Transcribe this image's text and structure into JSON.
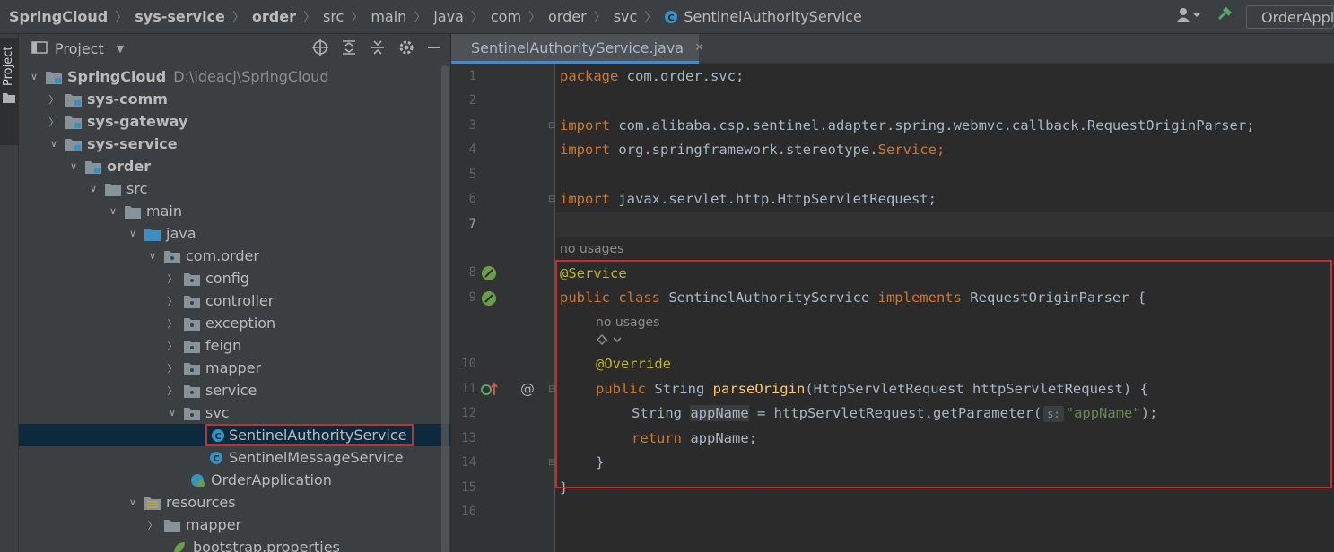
{
  "navbar": {
    "breadcrumbs": [
      "SpringCloud",
      "sys-service",
      "order",
      "src",
      "main",
      "java",
      "com",
      "order",
      "svc"
    ],
    "current_file": "SentinelAuthorityService",
    "run_config": "OrderApplication"
  },
  "stripe": {
    "label": "Project"
  },
  "project_panel": {
    "title": "Project",
    "tree": [
      {
        "label": "SpringCloud",
        "path": "D:\\ideacj\\SpringCloud",
        "bold": true,
        "expanded": true,
        "icon": "module"
      },
      {
        "label": "sys-comm",
        "bold": true,
        "expanded": false,
        "icon": "module"
      },
      {
        "label": "sys-gateway",
        "bold": true,
        "expanded": false,
        "icon": "module"
      },
      {
        "label": "sys-service",
        "bold": true,
        "expanded": true,
        "icon": "module"
      },
      {
        "label": "order",
        "bold": true,
        "expanded": true,
        "icon": "module"
      },
      {
        "label": "src",
        "expanded": true,
        "icon": "folder"
      },
      {
        "label": "main",
        "expanded": true,
        "icon": "folder"
      },
      {
        "label": "java",
        "expanded": true,
        "icon": "source-folder"
      },
      {
        "label": "com.order",
        "expanded": true,
        "icon": "package"
      },
      {
        "label": "config",
        "expanded": false,
        "icon": "package"
      },
      {
        "label": "controller",
        "expanded": false,
        "icon": "package"
      },
      {
        "label": "exception",
        "expanded": false,
        "icon": "package"
      },
      {
        "label": "feign",
        "expanded": false,
        "icon": "package"
      },
      {
        "label": "mapper",
        "expanded": false,
        "icon": "package"
      },
      {
        "label": "service",
        "expanded": false,
        "icon": "package"
      },
      {
        "label": "svc",
        "expanded": true,
        "icon": "package"
      },
      {
        "label": "SentinelAuthorityService",
        "icon": "class",
        "selected": true
      },
      {
        "label": "SentinelMessageService",
        "icon": "class"
      },
      {
        "label": "OrderApplication",
        "icon": "spring-class"
      },
      {
        "label": "resources",
        "expanded": true,
        "icon": "resources-folder"
      },
      {
        "label": "mapper",
        "expanded": false,
        "icon": "folder"
      },
      {
        "label": "bootstrap.properties",
        "icon": "properties-file"
      }
    ]
  },
  "editor": {
    "tab_label": "SentinelAuthorityService.java",
    "line_numbers": [
      "1",
      "2",
      "3",
      "4",
      "5",
      "6",
      "7",
      "8",
      "9",
      "10",
      "11",
      "12",
      "13",
      "14",
      "15",
      "16"
    ],
    "code": {
      "l1_kw": "package",
      "l1_rest": " com.order.svc;",
      "l3_kw": "import",
      "l3_rest": " com.alibaba.csp.sentinel.adapter.spring.webmvc.callback.RequestOriginParser;",
      "l4_kw": "import",
      "l4_rest": " org.springframework.stereotype.",
      "l4_cls": "Service",
      "l4_end": ";",
      "l6_kw": "import",
      "l6_rest": " javax.servlet.http.HttpServletRequest;",
      "hint_no_usages_1": "no usages",
      "l8_ann": "@Service",
      "l9_kw1": "public class",
      "l9_name": " SentinelAuthorityService ",
      "l9_kw2": "implements",
      "l9_rest": " RequestOriginParser {",
      "hint_no_usages_2": "no usages",
      "l10_ann": "@Override",
      "l11_kw": "public",
      "l11_type": " String ",
      "l11_fn": "parseOrigin",
      "l11_rest": "(HttpServletRequest httpServletRequest) {",
      "l12_type": "String ",
      "l12_var": "appName",
      "l12_rest": " = httpServletRequest.getParameter(",
      "l12_hint": "s:",
      "l12_str": "\"appName\"",
      "l12_end": ");",
      "l13_kw": "return",
      "l13_rest": " appName;",
      "l14": "}",
      "l15": "}"
    }
  },
  "colors": {
    "keyword": "#cc7832",
    "annotation": "#bbb529",
    "function": "#ffc66d",
    "string": "#6a8759",
    "highlight_border": "#c03030",
    "selection": "#0d293e"
  }
}
